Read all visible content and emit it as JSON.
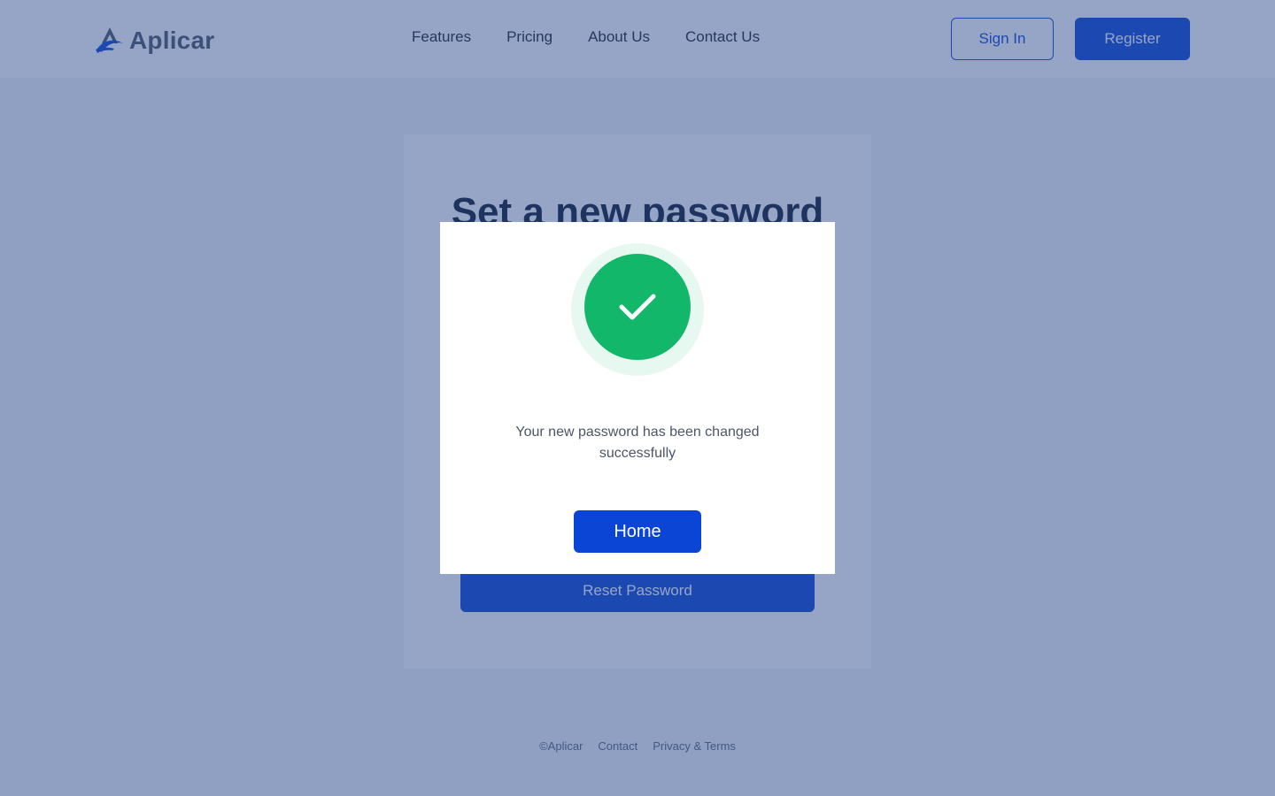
{
  "header": {
    "logo_text": "Aplicar",
    "nav": [
      "Features",
      "Pricing",
      "About Us",
      "Contact Us"
    ],
    "signin_label": "Sign In",
    "register_label": "Register"
  },
  "card": {
    "title": "Set a new password",
    "reset_label": "Reset Password"
  },
  "modal": {
    "message": "Your new password has been changed successfully",
    "home_label": "Home",
    "icon": "check-icon"
  },
  "footer": {
    "copyright": "©Aplicar",
    "contact": "Contact",
    "privacy": "Privacy  & Terms"
  },
  "colors": {
    "primary": "#0a45d6",
    "success": "#12b76a",
    "success_halo": "#e6f8f0"
  }
}
